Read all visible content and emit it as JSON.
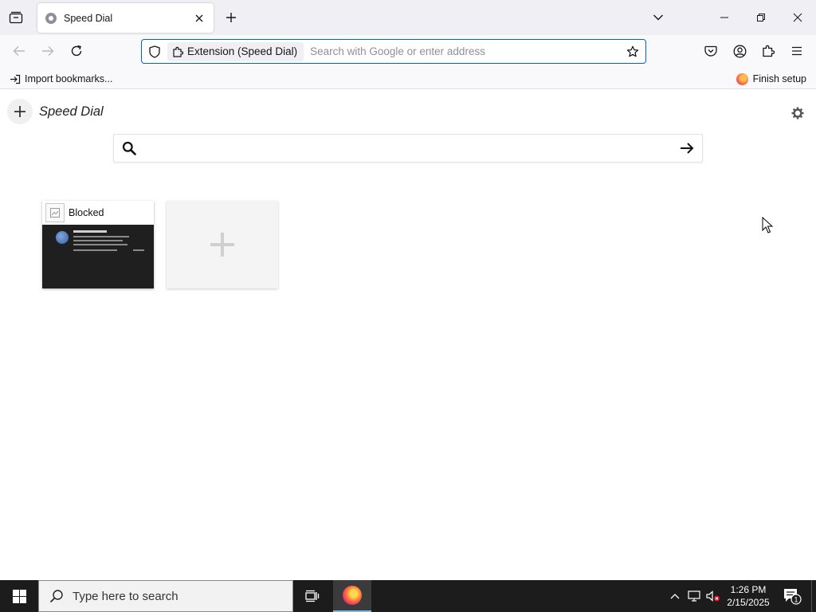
{
  "browser": {
    "tab": {
      "title": "Speed Dial"
    },
    "urlbar": {
      "identity_label": "Extension (Speed Dial)",
      "placeholder": "Search with Google or enter address",
      "value": ""
    },
    "bookmarks": {
      "import_label": "Import bookmarks...",
      "finish_setup_label": "Finish setup"
    }
  },
  "speed_dial": {
    "title": "Speed Dial",
    "search": {
      "placeholder": "",
      "value": ""
    },
    "dials": [
      {
        "label": "Blocked",
        "thumbnail": "blocked-page-dark"
      }
    ],
    "add_tile_icon": "plus-icon"
  },
  "taskbar": {
    "search_label": "Type here to search",
    "clock": {
      "time": "1:26 PM",
      "date": "2/15/2025"
    },
    "notification_count": "1"
  },
  "colors": {
    "accent": "#0061e0",
    "tab_strip": "#f0f0f4",
    "toolbar": "#f9f9fb",
    "taskbar": "#1c1c1c",
    "dial_thumbnail": "#1e1e1e"
  }
}
